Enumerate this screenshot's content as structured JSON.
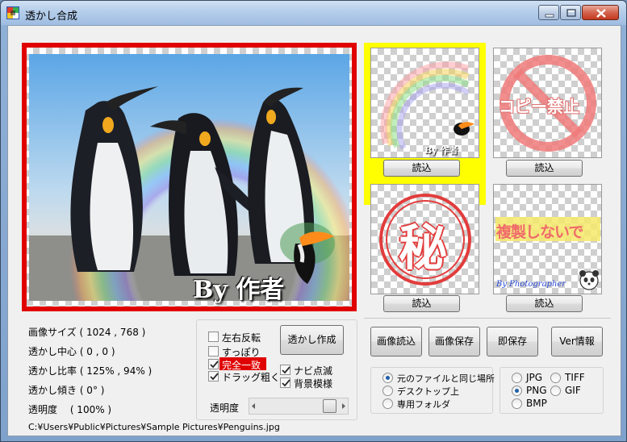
{
  "window": {
    "title": "透かし合成"
  },
  "main_preview": {
    "watermark_text": "By 作者"
  },
  "thumbnails": [
    {
      "name": "rainbow-toucan",
      "caption": "By 作者",
      "load_label": "読込",
      "selected": true
    },
    {
      "name": "no-copy",
      "caption": "コピー禁止",
      "load_label": "読込",
      "selected": false
    },
    {
      "name": "secret-seal",
      "caption": "秘",
      "load_label": "読込",
      "selected": false
    },
    {
      "name": "do-not-duplicate",
      "caption": "複製しないで",
      "subcaption": "By Photographer",
      "load_label": "読込",
      "selected": false
    }
  ],
  "info": {
    "image_size": "画像サイズ ( 1024 , 768 )",
    "watermark_center": "透かし中心 ( 0 , 0 )",
    "watermark_ratio": "透かし比率 ( 125% , 94% )",
    "watermark_tilt": "透かし傾き ( 0° )",
    "opacity_value": "透明度　 ( 100% )"
  },
  "options": {
    "flip_horizontal": {
      "label": "左右反転",
      "checked": false
    },
    "fit_exact": {
      "label": "すっぽり",
      "checked": false
    },
    "exact_match": {
      "label": "完全一致",
      "checked": true
    },
    "drag_coarse": {
      "label": "ドラッグ粗く",
      "checked": true
    },
    "nav_blink": {
      "label": "ナビ点滅",
      "checked": true
    },
    "bg_pattern": {
      "label": "背景模様",
      "checked": true
    },
    "opacity_label": "透明度",
    "opacity_slider_value": 100
  },
  "buttons": {
    "create_watermark": "透かし作成",
    "load_image": "画像読込",
    "save_image": "画像保存",
    "quick_save": "即保存",
    "version_info": "Ver情報"
  },
  "save_location": {
    "options": [
      "元のファイルと同じ場所",
      "デスクトップ上",
      "専用フォルダ"
    ],
    "selected_index": 0
  },
  "format": {
    "options": [
      "JPG",
      "TIFF",
      "PNG",
      "GIF",
      "BMP"
    ],
    "selected": "PNG"
  },
  "status": {
    "file_path": "C:¥Users¥Public¥Pictures¥Sample Pictures¥Penguins.jpg"
  },
  "colors": {
    "selected_border": "#e00000",
    "thumb_selected": "#ffff00",
    "exact_match_bg": "#e00000"
  }
}
